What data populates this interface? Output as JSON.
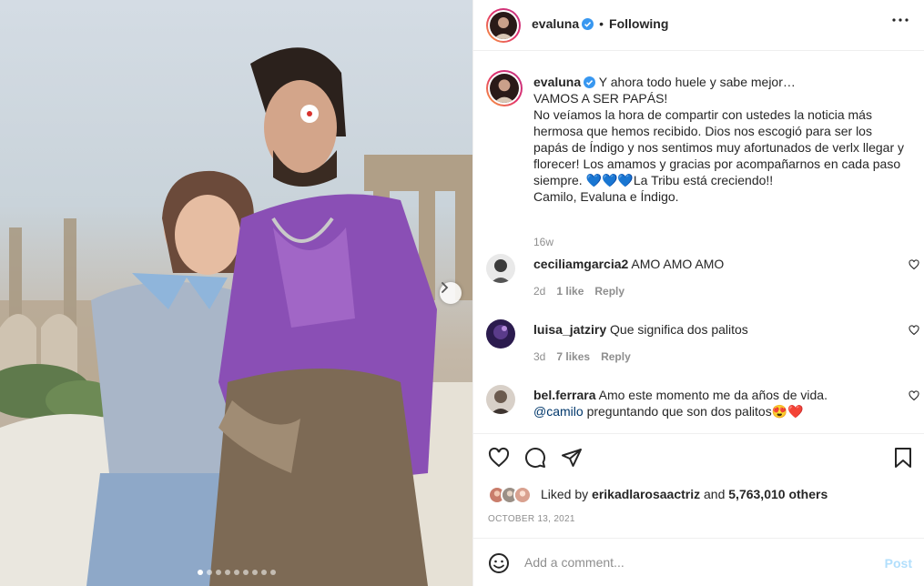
{
  "post": {
    "author": "evaluna",
    "follow_status": "Following",
    "header_separator": "•",
    "caption": "Y ahora todo huele y sabe mejor…\nVAMOS A SER PAPÁS!\nNo veíamos la hora de compartir con ustedes la noticia más hermosa que hemos recibido. Dios nos escogió para ser los papás de Índigo y nos sentimos muy afortunados de verlx llegar y florecer! Los amamos y gracias por acompañarnos en cada paso siempre. 💙💙💙La Tribu está creciendo!!\nCamilo, Evaluna e Índigo.",
    "caption_time": "16w",
    "date": "OCTOBER 13, 2021",
    "carousel": {
      "slides": 9,
      "active_slide": 0
    }
  },
  "comments": [
    {
      "user": "ceciliamgarcia2",
      "text": "AMO AMO AMO",
      "time": "2d",
      "likes": "1 like",
      "reply": "Reply"
    },
    {
      "user": "luisa_jatziry",
      "text": "Que significa dos palitos",
      "time": "3d",
      "likes": "7 likes",
      "reply": "Reply"
    },
    {
      "user": "bel.ferrara",
      "text": "Amo este momento me da años de vida.",
      "mention": "@camilo",
      "text2": "preguntando que son dos palitos😍❤️"
    }
  ],
  "likes": {
    "prefix": "Liked by",
    "user": "erikadlarosaactriz",
    "conj": "and",
    "others": "5,763,010 others"
  },
  "add_comment": {
    "placeholder": "Add a comment...",
    "post_label": "Post"
  },
  "icons": {
    "header": [
      "verified-badge-icon",
      "more-options-icon"
    ],
    "actions": [
      "heart-icon",
      "comment-icon",
      "share-icon",
      "bookmark-icon"
    ],
    "next": "chevron-right-icon",
    "emoji": "emoji-icon"
  },
  "colors": {
    "verified": "#3897f0",
    "link": "#00376b",
    "post_disabled": "#b2dffc",
    "muted": "#8e8e8e"
  }
}
